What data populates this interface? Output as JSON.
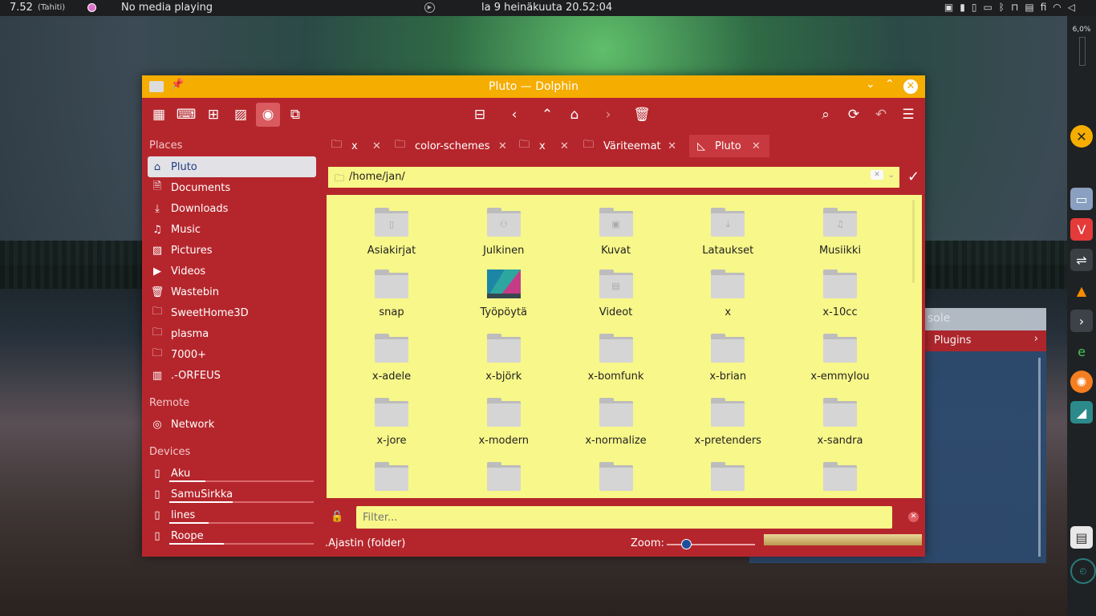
{
  "top_panel": {
    "time": "7.52",
    "timezone": "(Tahiti)",
    "media": "No media playing",
    "date": "la 9 heinäkuuta 20.52:04",
    "keyboard_layout": "fi"
  },
  "dock": {
    "cpu": "6,0%"
  },
  "window": {
    "title": "Pluto — Dolphin",
    "location": "/home/jan/",
    "filter_placeholder": "Filter...",
    "status_text": ".Ajastin (folder)",
    "zoom_label": "Zoom:",
    "zoom_level": 0.2
  },
  "places": {
    "sections": {
      "places": "Places",
      "remote": "Remote",
      "devices": "Devices"
    },
    "items": [
      {
        "label": "Pluto",
        "icon": "home-icon"
      },
      {
        "label": "Documents",
        "icon": "documents-icon"
      },
      {
        "label": "Downloads",
        "icon": "downloads-icon"
      },
      {
        "label": "Music",
        "icon": "music-icon"
      },
      {
        "label": "Pictures",
        "icon": "pictures-icon"
      },
      {
        "label": "Videos",
        "icon": "videos-icon"
      },
      {
        "label": "Wastebin",
        "icon": "trash-icon"
      },
      {
        "label": "SweetHome3D",
        "icon": "folder-icon"
      },
      {
        "label": "plasma",
        "icon": "folder-icon"
      },
      {
        "label": "7000+",
        "icon": "folder-icon"
      },
      {
        "label": ".-ORFEUS",
        "icon": "orfeus-icon"
      }
    ],
    "remote": [
      {
        "label": "Network",
        "icon": "network-icon"
      }
    ],
    "devices": [
      {
        "label": "Aku",
        "usage": 0.25
      },
      {
        "label": "SamuSirkka",
        "usage": 0.44
      },
      {
        "label": "lines",
        "usage": 0.27
      },
      {
        "label": "Roope",
        "usage": 0.38
      }
    ]
  },
  "tabs": [
    {
      "label": "x"
    },
    {
      "label": "color-schemes"
    },
    {
      "label": "x"
    },
    {
      "label": "Väriteemat"
    },
    {
      "label": "Pluto"
    }
  ],
  "files": [
    {
      "name": "Asiakirjat",
      "emblem": "document-emblem"
    },
    {
      "name": "Julkinen",
      "emblem": "share-emblem"
    },
    {
      "name": "Kuvat",
      "emblem": "image-emblem"
    },
    {
      "name": "Lataukset",
      "emblem": "download-emblem"
    },
    {
      "name": "Musiikki",
      "emblem": "music-emblem"
    },
    {
      "name": "snap",
      "emblem": ""
    },
    {
      "name": "Työpöytä",
      "emblem": "thumbnail"
    },
    {
      "name": "Videot",
      "emblem": "video-emblem"
    },
    {
      "name": "x",
      "emblem": ""
    },
    {
      "name": "x-10cc",
      "emblem": ""
    },
    {
      "name": "x-adele",
      "emblem": ""
    },
    {
      "name": "x-björk",
      "emblem": ""
    },
    {
      "name": "x-bomfunk",
      "emblem": ""
    },
    {
      "name": "x-brian",
      "emblem": ""
    },
    {
      "name": "x-emmylou",
      "emblem": ""
    },
    {
      "name": "x-jore",
      "emblem": ""
    },
    {
      "name": "x-modern",
      "emblem": ""
    },
    {
      "name": "x-normalize",
      "emblem": ""
    },
    {
      "name": "x-pretenders",
      "emblem": ""
    },
    {
      "name": "x-sandra",
      "emblem": ""
    },
    {
      "name": "",
      "emblem": ""
    },
    {
      "name": "",
      "emblem": ""
    },
    {
      "name": "",
      "emblem": ""
    },
    {
      "name": "",
      "emblem": ""
    },
    {
      "name": "",
      "emblem": ""
    }
  ],
  "console_window": {
    "title": "sole",
    "plugins": "Plugins"
  },
  "colors": {
    "accent": "#b5262c",
    "titlebar": "#f5ad00",
    "view_bg": "#f7f78a",
    "selection": "#e2e2e6"
  }
}
